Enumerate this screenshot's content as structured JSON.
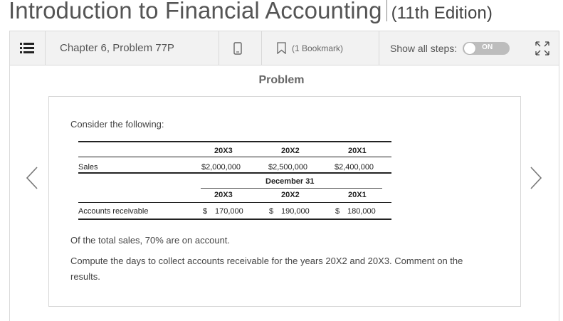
{
  "book": {
    "title": "Introduction to Financial Accounting",
    "edition": "(11th Edition)"
  },
  "toolbar": {
    "chapter": "Chapter 6, Problem 77P",
    "bookmark": "(1 Bookmark)",
    "show_steps": "Show all steps:",
    "toggle": "ON"
  },
  "icons": {
    "menu": "list-icon",
    "device": "phone-icon",
    "bookmark": "bookmark-icon",
    "expand": "expand-icon",
    "prev": "chevron-left-icon",
    "next": "chevron-right-icon"
  },
  "problem": {
    "heading": "Problem",
    "intro": "Consider the following:",
    "table": {
      "years1": [
        "20X3",
        "20X2",
        "20X1"
      ],
      "sales_label": "Sales",
      "sales": [
        "$2,000,000",
        "$2,500,000",
        "$2,400,000"
      ],
      "section": "December 31",
      "years2": [
        "20X3",
        "20X2",
        "20X1"
      ],
      "ar_label": "Accounts receivable",
      "ar": [
        {
          "sym": "$",
          "val": "170,000"
        },
        {
          "sym": "$",
          "val": "190,000"
        },
        {
          "sym": "$",
          "val": "180,000"
        }
      ]
    },
    "note": "Of the total sales, 70% are on account.",
    "question_line1": "Compute the days to collect accounts receivable for the years 20X2 and 20X3. Comment on the",
    "question_line2": "results."
  }
}
